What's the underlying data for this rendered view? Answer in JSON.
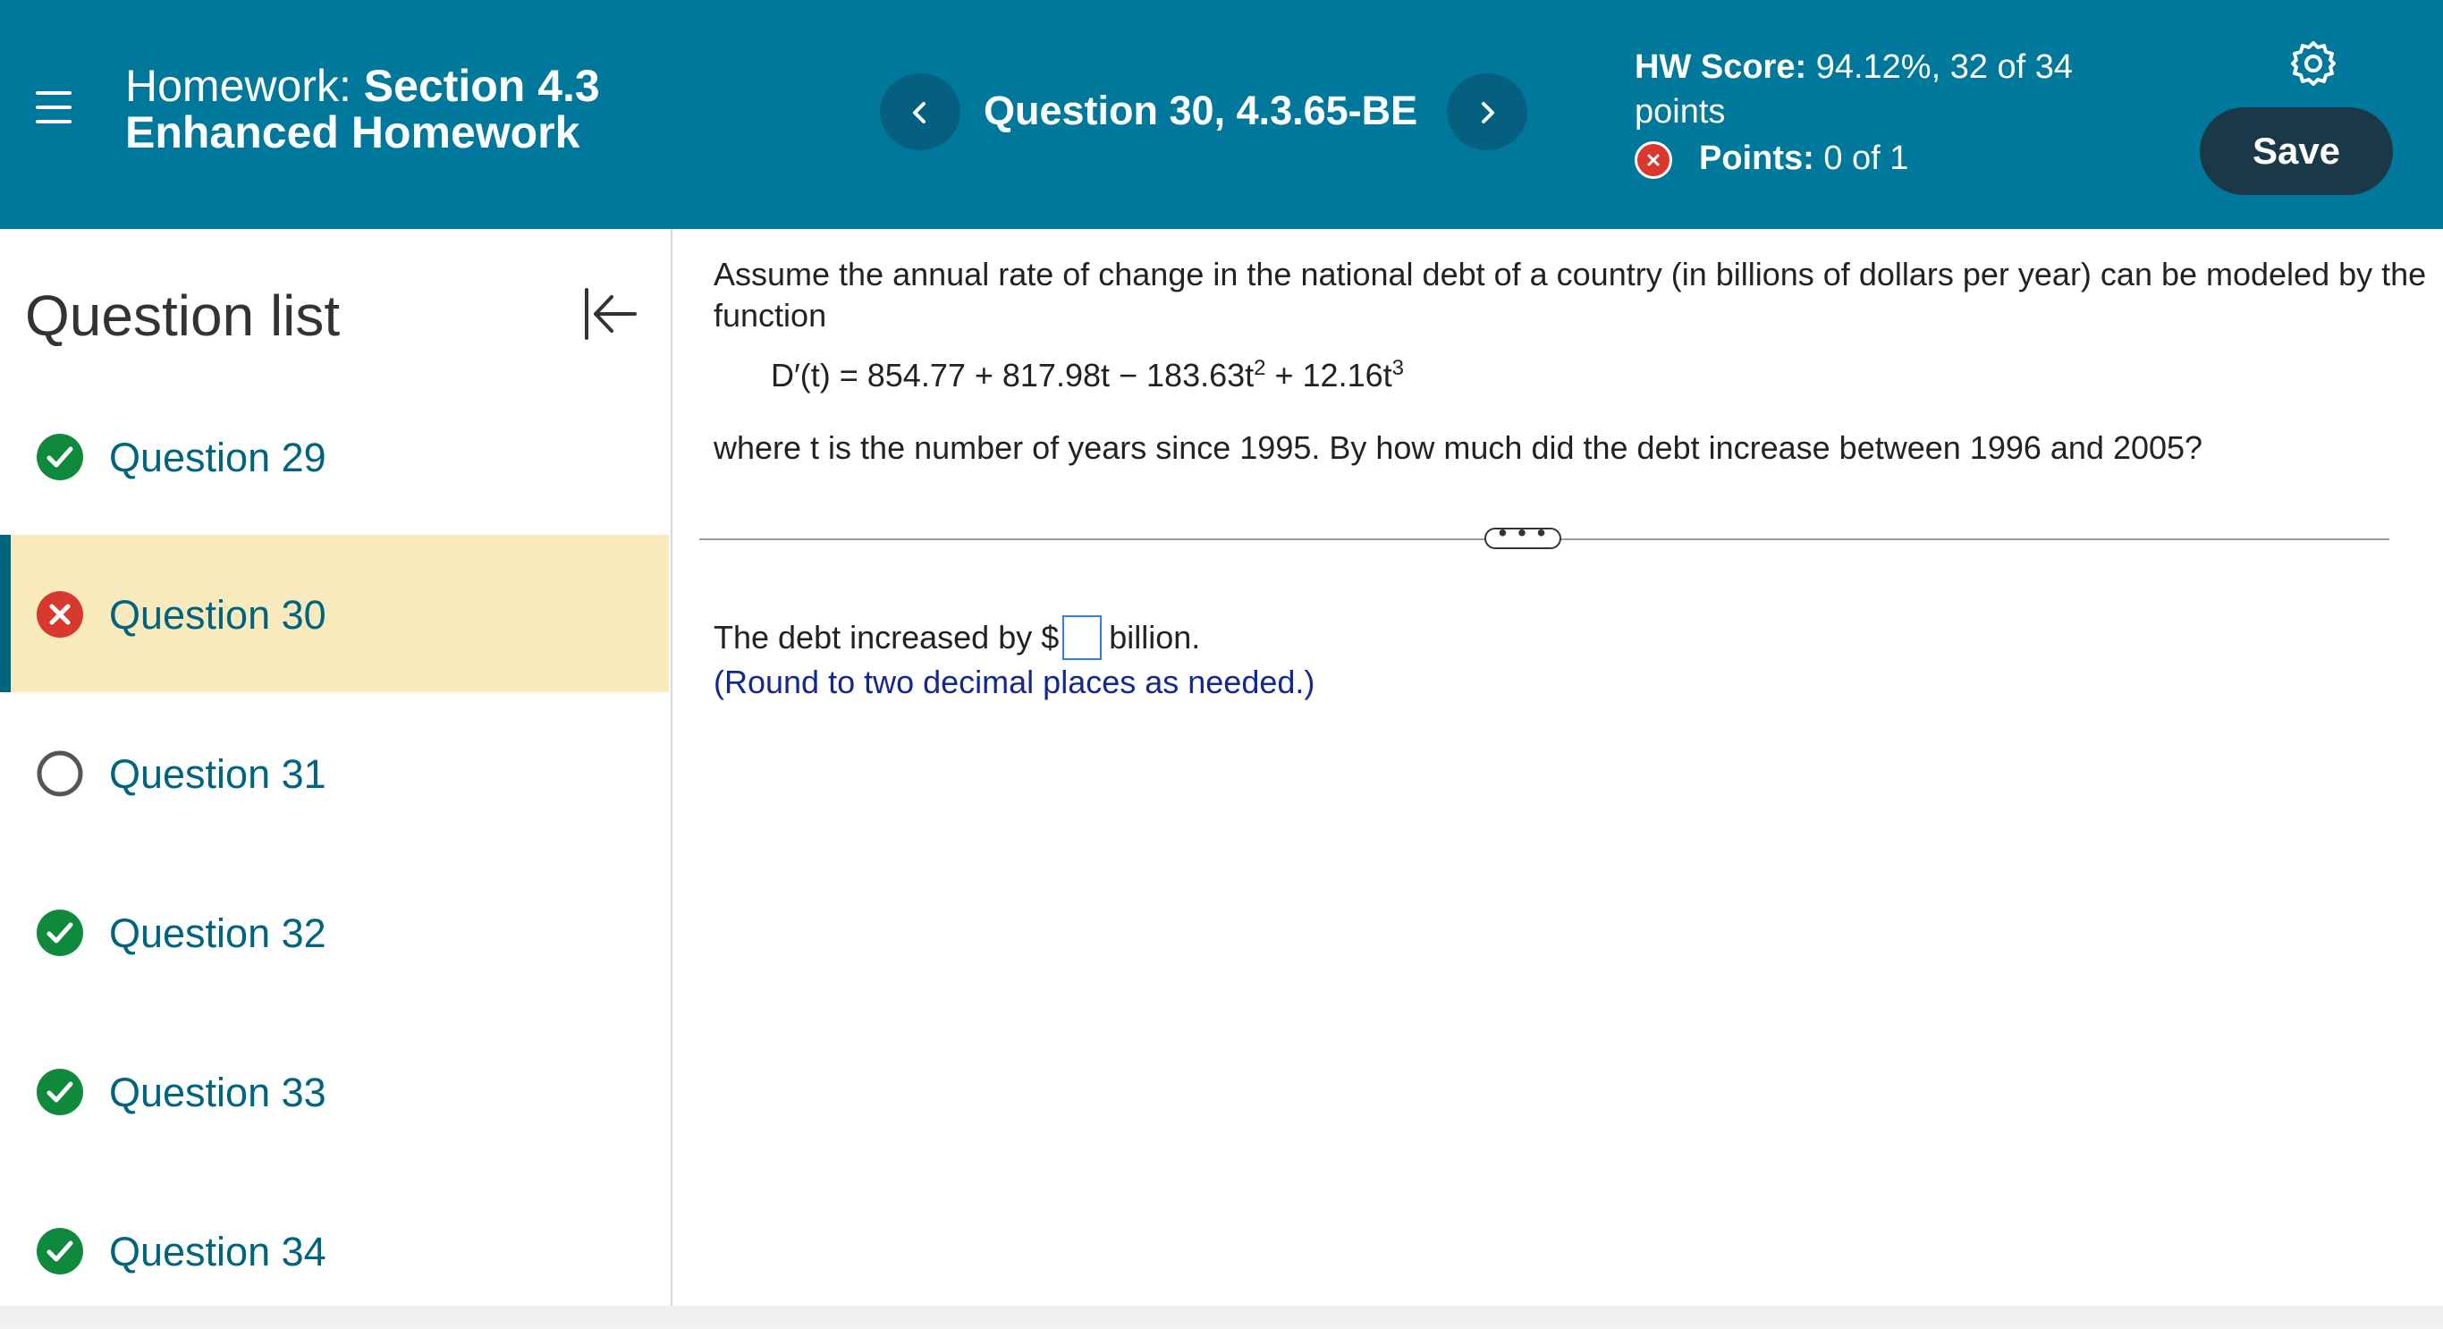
{
  "header": {
    "hw_prefix": "Homework:",
    "hw_section": "Section 4.3",
    "hw_name": "Enhanced Homework",
    "question_title": "Question 30, 4.3.65-BE",
    "score_label": "HW Score:",
    "score_value": "94.12%, 32 of 34 points",
    "points_label": "Points:",
    "points_value": "0 of 1",
    "save_label": "Save",
    "colors": {
      "bar": "#00789c",
      "save": "#1b3849",
      "wrong": "#d9392c"
    }
  },
  "sidebar": {
    "title": "Question list",
    "items": [
      {
        "label": "Question 29",
        "status": "check-icon"
      },
      {
        "label": "Question 30",
        "status": "x-icon"
      },
      {
        "label": "Question 31",
        "status": "empty-circle-icon"
      },
      {
        "label": "Question 32",
        "status": "check-icon"
      },
      {
        "label": "Question 33",
        "status": "check-icon"
      },
      {
        "label": "Question 34",
        "status": "check-icon"
      }
    ]
  },
  "main": {
    "intro": "Assume the annual rate of change in the national debt of a country (in billions of dollars per year) can be modeled by the function",
    "formula_lhs": "D′(t) = 854.77 + 817.98t − 183.63t",
    "formula_exp1": "2",
    "formula_mid": " + 12.16t",
    "formula_exp2": "3",
    "question": "where t is the number of years since 1995. By how much did the debt increase between 1996 and 2005?",
    "more_label": "• • •",
    "answer_prefix": "The debt increased by $",
    "answer_value": "",
    "answer_suffix": "billion.",
    "hint": "(Round to two decimal places as needed.)"
  }
}
